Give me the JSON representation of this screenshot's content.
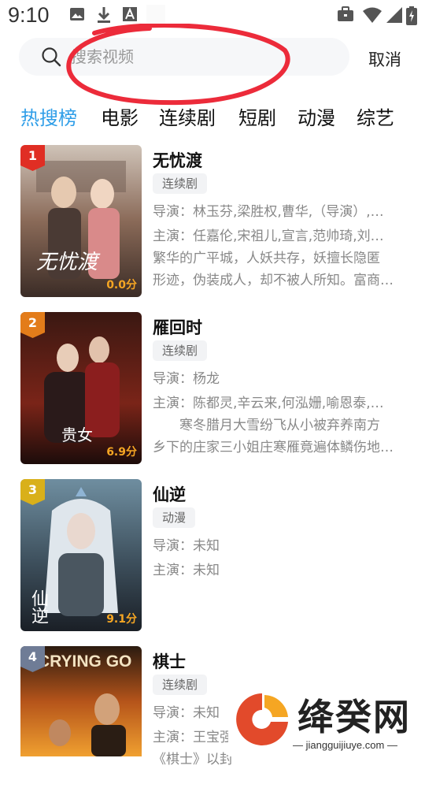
{
  "status_bar": {
    "time": "9:10",
    "left_icons": [
      "gallery-icon",
      "download-icon",
      "font-icon",
      "blank-icon"
    ],
    "right_icons": [
      "briefcase-icon",
      "wifi-icon",
      "signal-icon",
      "battery-charging-icon"
    ]
  },
  "search": {
    "placeholder": "搜索视频",
    "value": "",
    "cancel_label": "取消"
  },
  "tabs": [
    {
      "label": "热搜榜",
      "active": true
    },
    {
      "label": "电影",
      "active": false
    },
    {
      "label": "连续剧",
      "active": false
    },
    {
      "label": "短剧",
      "active": false
    },
    {
      "label": "动漫",
      "active": false
    },
    {
      "label": "综艺",
      "active": false
    }
  ],
  "items": [
    {
      "rank": "1",
      "title": "无忧渡",
      "poster_text": "无忧渡",
      "score": "0.0分",
      "tag": "连续剧",
      "director": "导演：林玉芬,梁胜权,曹华,（导演）,于中中,（导演）",
      "cast": "主演：任嘉伦,宋祖儿,宣言,范帅琦,刘端端",
      "desc_line1": "繁华的广平城，人妖共存，妖擅长隐匿",
      "desc_line2": "形迹，伪装成人，却不被人所知。富商之女",
      "colors": {
        "badge": "#e02e24"
      }
    },
    {
      "rank": "2",
      "title": "雁回时",
      "poster_text": "贵女",
      "score": "6.9分",
      "tag": "连续剧",
      "director": "导演：杨龙",
      "cast": "主演：陈都灵,辛云来,何泓姗,喻恩泰,王劲松",
      "desc_line1": "　　寒冬腊月大雪纷飞从小被弃养南方",
      "desc_line2": "乡下的庄家三小姐庄寒雁竟遍体鳞伤地回到",
      "colors": {
        "badge": "#e37c1a"
      }
    },
    {
      "rank": "3",
      "title": "仙逆",
      "poster_text": "仙逆",
      "score": "9.1分",
      "tag": "动漫",
      "director": "导演：未知",
      "cast": "主演：未知",
      "desc_line1": "",
      "desc_line2": "",
      "colors": {
        "badge": "#d9b01a"
      }
    },
    {
      "rank": "4",
      "title": "棋士",
      "poster_text": "CRYING GO",
      "score": "",
      "tag": "连续剧",
      "director": "导演：未知",
      "cast": "主演：王宝强",
      "desc_line1": "《棋士》以封",
      "desc_line2": "",
      "colors": {
        "badge": "#6f7c96"
      }
    }
  ],
  "watermark": {
    "name": "绛癸网",
    "url": "— jiangguijiuye.com —"
  },
  "colors": {
    "accent": "#2f9ee8",
    "annotation": "#ec2b3a"
  }
}
